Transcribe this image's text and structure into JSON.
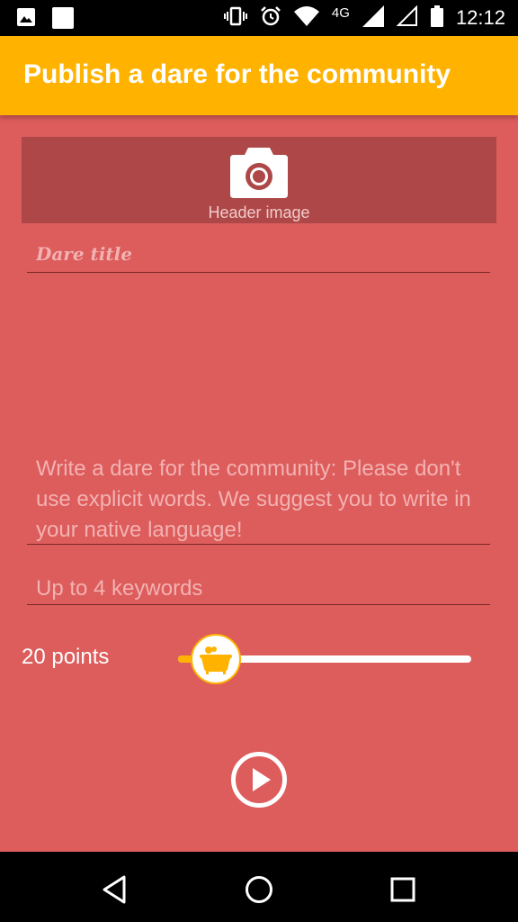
{
  "status_bar": {
    "time": "12:12",
    "network": "4G",
    "icons": [
      "image-icon",
      "notification-square-icon",
      "vibrate-icon",
      "alarm-icon",
      "wifi-icon",
      "signal-icon",
      "signal-empty-icon",
      "battery-icon"
    ]
  },
  "app_bar": {
    "title": "Publish a dare for the community",
    "color": "#ffb300"
  },
  "form": {
    "background": "#dd5c5c",
    "header_image": {
      "label": "Header image",
      "icon": "camera-icon"
    },
    "title_field": {
      "placeholder": "Dare title",
      "value": ""
    },
    "description_field": {
      "placeholder": "Write a dare for the community: Please don't use explicit words. We suggest you to write in your native language!",
      "value": ""
    },
    "keywords_field": {
      "placeholder": "Up to 4 keywords",
      "value": ""
    },
    "points": {
      "label": "20 points",
      "value": 20,
      "slider_fraction": 0.13,
      "thumb_icon": "bathtub-icon"
    },
    "submit": {
      "icon": "play-circle-icon"
    }
  },
  "nav_bar": {
    "icons": [
      "back-triangle-icon",
      "home-circle-icon",
      "recents-square-icon"
    ]
  }
}
